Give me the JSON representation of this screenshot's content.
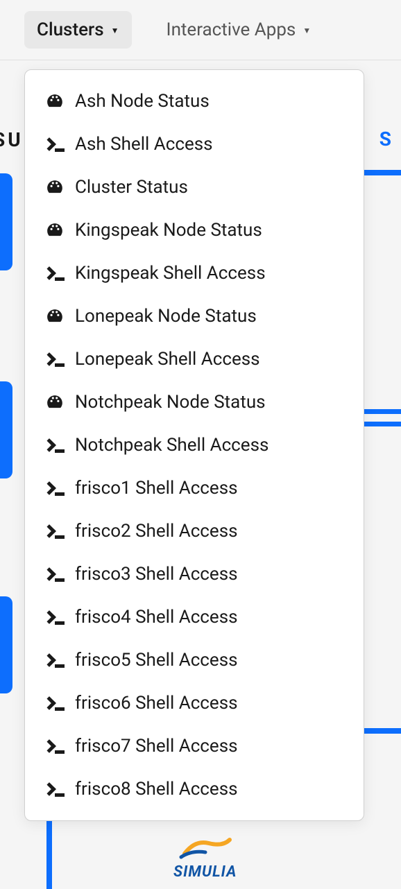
{
  "navbar": {
    "clusters": "Clusters",
    "interactive_apps": "Interactive Apps"
  },
  "background": {
    "left_text": "SU",
    "right_text": "S",
    "logo_text": "SIMULIA"
  },
  "dropdown": {
    "items": [
      {
        "type": "gauge",
        "label": "Ash Node Status"
      },
      {
        "type": "shell",
        "label": "Ash Shell Access"
      },
      {
        "type": "gauge",
        "label": "Cluster Status"
      },
      {
        "type": "gauge",
        "label": "Kingspeak Node Status"
      },
      {
        "type": "shell",
        "label": "Kingspeak Shell Access"
      },
      {
        "type": "gauge",
        "label": "Lonepeak Node Status"
      },
      {
        "type": "shell",
        "label": "Lonepeak Shell Access"
      },
      {
        "type": "gauge",
        "label": "Notchpeak Node Status"
      },
      {
        "type": "shell",
        "label": "Notchpeak Shell Access"
      },
      {
        "type": "shell",
        "label": "frisco1 Shell Access"
      },
      {
        "type": "shell",
        "label": "frisco2 Shell Access"
      },
      {
        "type": "shell",
        "label": "frisco3 Shell Access"
      },
      {
        "type": "shell",
        "label": "frisco4 Shell Access"
      },
      {
        "type": "shell",
        "label": "frisco5 Shell Access"
      },
      {
        "type": "shell",
        "label": "frisco6 Shell Access"
      },
      {
        "type": "shell",
        "label": "frisco7 Shell Access"
      },
      {
        "type": "shell",
        "label": "frisco8 Shell Access"
      }
    ]
  }
}
